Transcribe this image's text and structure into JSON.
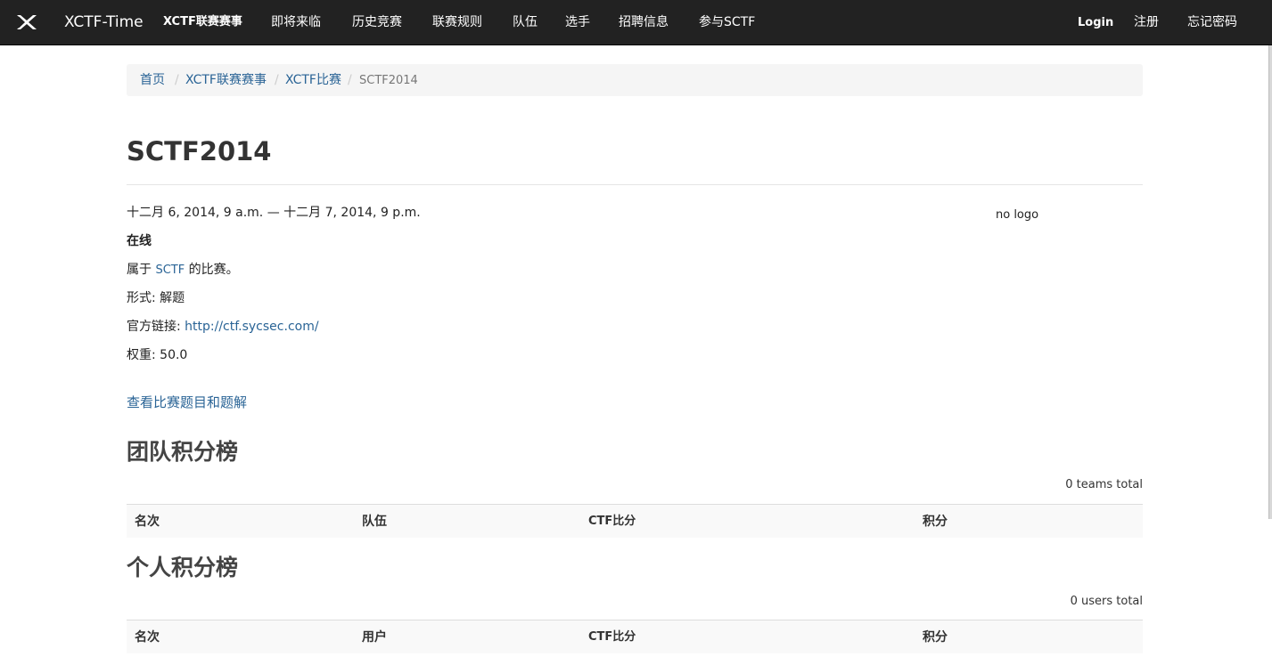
{
  "navbar": {
    "brand": "XCTF-Time",
    "items": [
      "XCTF联赛赛事",
      "即将来临",
      "历史竞赛",
      "联赛规则",
      "队伍",
      "选手",
      "招聘信息",
      "参与SCTF"
    ],
    "right": [
      "Login",
      "注册",
      "忘记密码"
    ]
  },
  "breadcrumb": [
    "首页",
    "XCTF联赛赛事",
    "XCTF比赛",
    "SCTF2014"
  ],
  "event": {
    "title": "SCTF2014",
    "date": "十二月 6, 2014, 9 a.m. — 十二月 7, 2014, 9 p.m.",
    "mode": "在线",
    "belongs_prefix": "属于",
    "belongs_link": "SCTF",
    "belongs_suffix": "的比赛。",
    "format_label": "形式:",
    "format_value": "解题",
    "official_label": "官方链接:",
    "official_url": "http://ctf.sycsec.com/",
    "weight_label": "权重:",
    "weight_value": "50.0",
    "logo_text": "no logo",
    "solutions_link": "查看比赛题目和题解"
  },
  "team_board": {
    "title": "团队积分榜",
    "total": "0 teams total",
    "columns": [
      "名次",
      "队伍",
      "CTF比分",
      "积分"
    ]
  },
  "user_board": {
    "title": "个人积分榜",
    "total": "0 users total",
    "columns": [
      "名次",
      "用户",
      "CTF比分",
      "积分"
    ]
  }
}
